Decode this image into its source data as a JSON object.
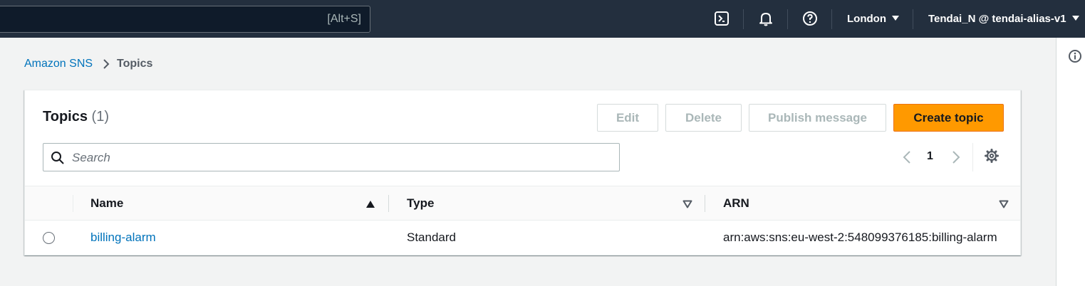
{
  "topnav": {
    "search_shortcut": "[Alt+S]",
    "region": "London",
    "account": "Tendai_N @ tendai-alias-v1"
  },
  "breadcrumb": {
    "service": "Amazon SNS",
    "current": "Topics"
  },
  "topics_panel": {
    "title": "Topics",
    "count": "(1)",
    "buttons": {
      "edit": "Edit",
      "delete": "Delete",
      "publish": "Publish message",
      "create": "Create topic"
    },
    "search_placeholder": "Search",
    "pagination": {
      "current_page": "1"
    },
    "columns": [
      {
        "label": "Name",
        "sort": "ascending"
      },
      {
        "label": "Type",
        "sort": "none"
      },
      {
        "label": "ARN",
        "sort": "none"
      }
    ],
    "rows": [
      {
        "name": "billing-alarm",
        "type": "Standard",
        "arn": "arn:aws:sns:eu-west-2:548099376185:billing-alarm"
      }
    ]
  },
  "colors": {
    "nav_bg": "#232f3e",
    "primary_button": "#ff9900",
    "link": "#0073bb",
    "page_bg": "#f2f3f3"
  }
}
